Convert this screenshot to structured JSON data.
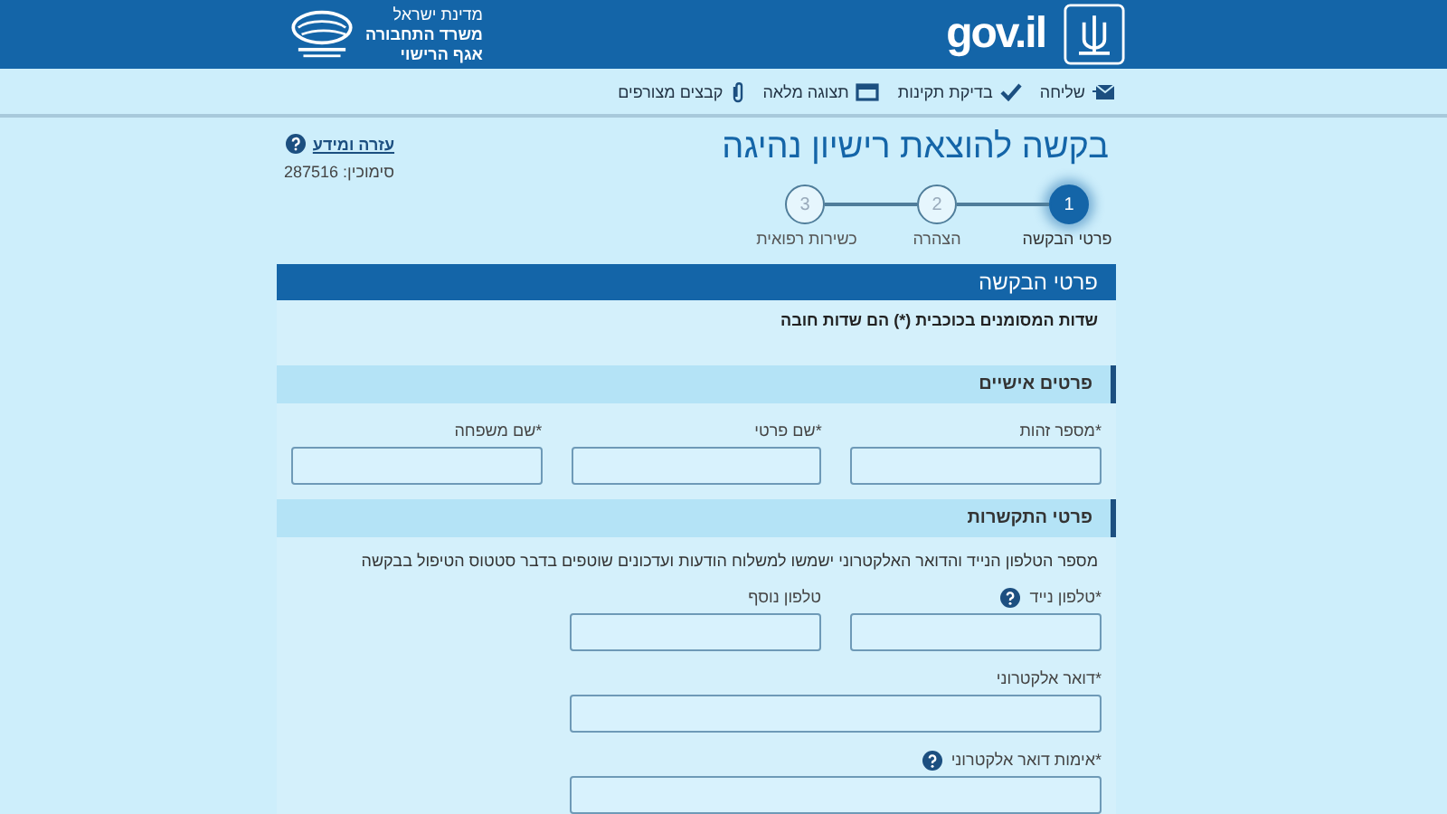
{
  "header": {
    "site_logo": "gov.il",
    "ministry_lines": [
      "מדינת ישראל",
      "משרד התחבורה",
      "אגף הרישוי"
    ]
  },
  "toolbar": [
    {
      "kind": "send",
      "label": "שליחה"
    },
    {
      "kind": "check",
      "label": "בדיקת תקינות"
    },
    {
      "kind": "preview",
      "label": "תצוגה מלאה"
    },
    {
      "kind": "attach",
      "label": "קבצים מצורפים"
    }
  ],
  "title": "בקשה להוצאת רישיון נהיגה",
  "help_link": "עזרה ומידע",
  "reference": "סימוכין: 287516",
  "steps": [
    {
      "number": "1",
      "label": "פרטי הבקשה",
      "selected": true
    },
    {
      "number": "2",
      "label": "הצהרה",
      "selected": false
    },
    {
      "number": "3",
      "label": "כשירות רפואית",
      "selected": false
    }
  ],
  "panel": {
    "title": "פרטי הבקשה",
    "required_note": "שדות המסומנים בכוכבית (*) הם שדות חובה",
    "sections": [
      {
        "title": "פרטים אישיים",
        "rows": [
          [
            {
              "label": "*מספר זהות",
              "help": false,
              "kind": "short"
            },
            {
              "label": "*שם פרטי",
              "help": false,
              "kind": "short"
            },
            {
              "label": "*שם משפחה",
              "help": false,
              "kind": "short"
            }
          ]
        ]
      },
      {
        "title": "פרטי התקשרות",
        "intro": "מספר הטלפון הנייד והדואר האלקטרוני ישמשו למשלוח הודעות ועדכונים שוטפים בדבר סטטוס הטיפול בבקשה",
        "rows": [
          [
            {
              "label": "*טלפון נייד",
              "help": true,
              "kind": "short"
            },
            {
              "label": "טלפון נוסף",
              "help": false,
              "kind": "short"
            }
          ],
          [
            {
              "label": "*דואר אלקטרוני",
              "help": false,
              "kind": "wide"
            }
          ],
          [
            {
              "label": "*אימות דואר אלקטרוני",
              "help": true,
              "kind": "wide"
            }
          ]
        ]
      }
    ]
  }
}
